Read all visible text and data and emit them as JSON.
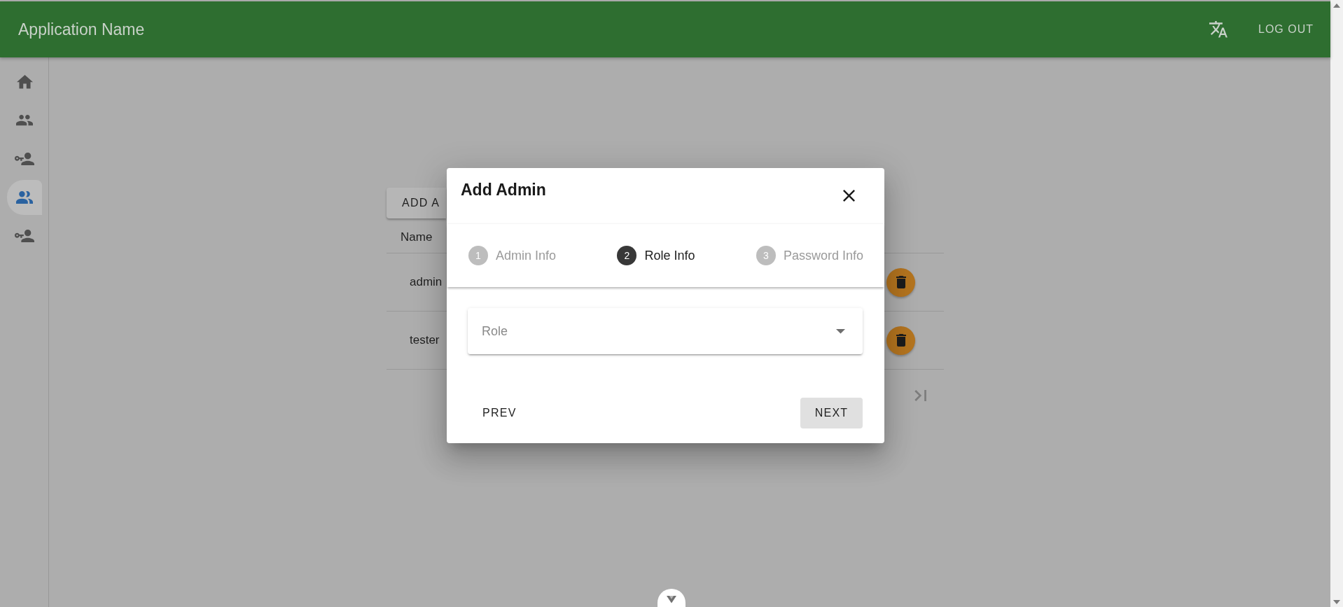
{
  "header": {
    "title": "Application Name",
    "logout": "LOG OUT"
  },
  "sidebar": {
    "items": [
      {
        "selected": false
      },
      {
        "selected": false
      },
      {
        "selected": false
      },
      {
        "selected": true
      },
      {
        "selected": false
      }
    ]
  },
  "admins_table": {
    "add_button": "ADD A",
    "columns": [
      "Name"
    ],
    "rows": [
      {
        "name": "admin"
      },
      {
        "name": "tester"
      }
    ]
  },
  "dialog": {
    "title": "Add Admin",
    "steps": [
      {
        "number": "1",
        "label": "Admin Info",
        "selected": false
      },
      {
        "number": "2",
        "label": "Role Info",
        "selected": true
      },
      {
        "number": "3",
        "label": "Password Info",
        "selected": false
      }
    ],
    "role_field": {
      "placeholder": "Role"
    },
    "actions": [
      {
        "kind": "text",
        "label": "PREV"
      },
      {
        "kind": "filled",
        "label": "NEXT"
      }
    ]
  }
}
